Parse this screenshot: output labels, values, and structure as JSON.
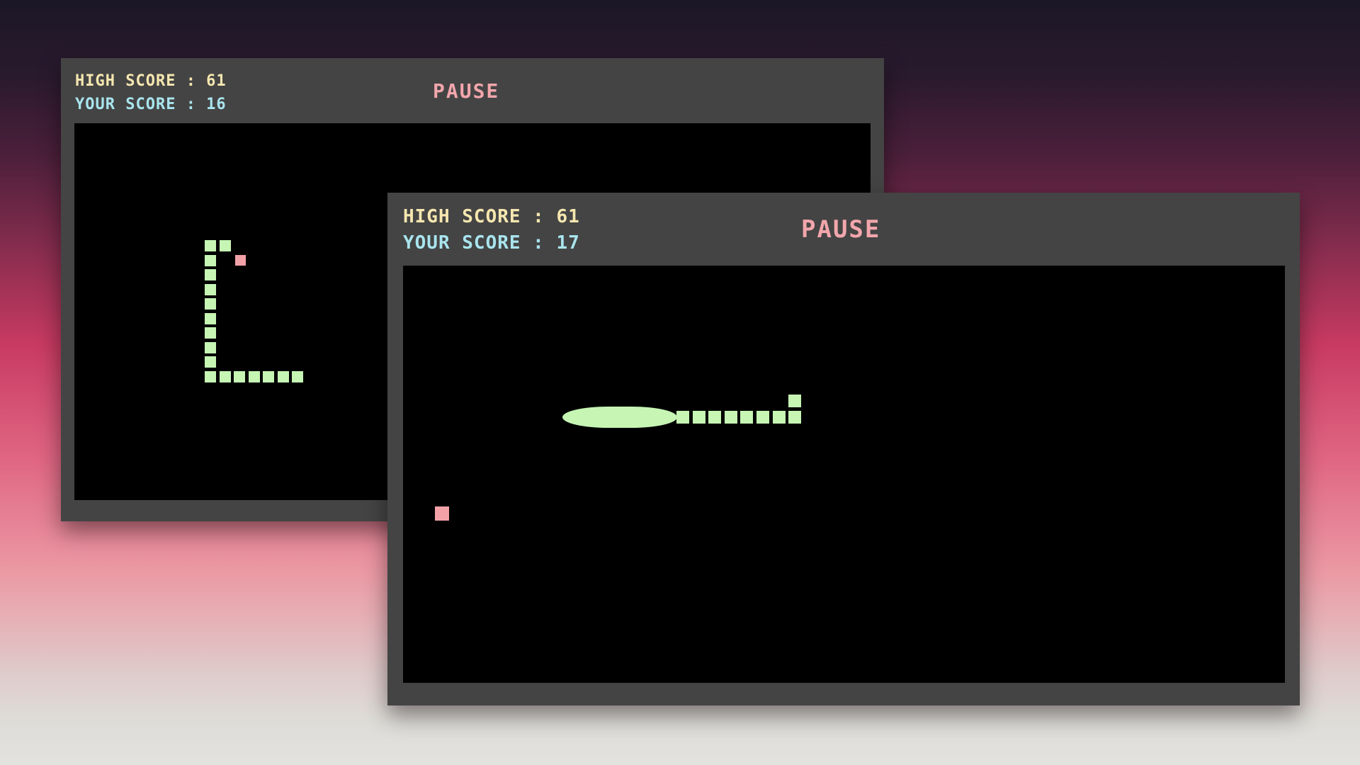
{
  "games": [
    {
      "id": "back",
      "high_score_text": "HIGH SCORE : 61",
      "your_score_text": "YOUR SCORE : 16",
      "pause_label": "PAUSE"
    },
    {
      "id": "front",
      "high_score_text": "HIGH SCORE : 61",
      "your_score_text": "YOUR SCORE : 17",
      "pause_label": "PAUSE"
    }
  ],
  "colors": {
    "snake": "#c6f5b4",
    "food": "#f2a2a7",
    "high_score": "#f6e7b0",
    "your_score": "#a9e5ee",
    "pause": "#f2a6ac",
    "board": "#000000",
    "window": "#444444"
  }
}
